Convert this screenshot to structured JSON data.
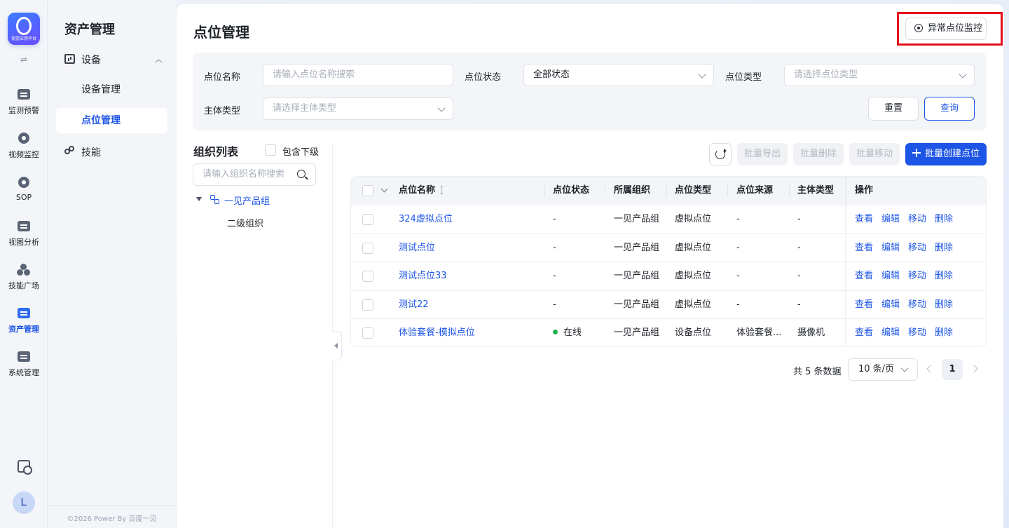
{
  "app": {
    "logo_caption": "视觉应用平台"
  },
  "rail": {
    "items": [
      {
        "label": "监测预警",
        "icon": "monitor-chart-icon"
      },
      {
        "label": "视频监控",
        "icon": "camera-icon"
      },
      {
        "label": "SOP",
        "icon": "sop-icon"
      },
      {
        "label": "视图分析",
        "icon": "view-analysis-icon"
      },
      {
        "label": "技能广场",
        "icon": "skill-square-icon"
      },
      {
        "label": "资产管理",
        "icon": "asset-icon",
        "active": true
      },
      {
        "label": "系统管理",
        "icon": "system-icon"
      }
    ],
    "avatar_initial": "L"
  },
  "sidebar": {
    "title": "资产管理",
    "group_label": "设备",
    "sub_items": [
      "设备管理",
      "点位管理"
    ],
    "skill_label": "技能",
    "footer": "©2026 Power By 百度一见"
  },
  "page": {
    "title": "点位管理",
    "monitor_button": "异常点位监控"
  },
  "filters": {
    "name_label": "点位名称",
    "name_placeholder": "请输入点位名称搜索",
    "status_label": "点位状态",
    "status_value": "全部状态",
    "type_label": "点位类型",
    "type_placeholder": "请选择点位类型",
    "subject_label": "主体类型",
    "subject_placeholder": "请选择主体类型",
    "reset": "重置",
    "query": "查询"
  },
  "org": {
    "title": "组织列表",
    "include_sub": "包含下级",
    "search_placeholder": "请输入组织名称搜索",
    "root": "一见产品组",
    "child": "二级组织"
  },
  "toolbar": {
    "export": "批量导出",
    "delete": "批量删除",
    "move": "批量移动",
    "create": "批量创建点位"
  },
  "table": {
    "headers": [
      "点位名称",
      "点位状态",
      "所属组织",
      "点位类型",
      "点位来源",
      "主体类型",
      "操作"
    ],
    "ops": [
      "查看",
      "编辑",
      "移动",
      "删除"
    ],
    "rows": [
      {
        "name": "324虚拟点位",
        "status": "-",
        "org": "一见产品组",
        "type": "虚拟点位",
        "source": "-",
        "subject": "-"
      },
      {
        "name": "测试点位",
        "status": "-",
        "org": "一见产品组",
        "type": "虚拟点位",
        "source": "-",
        "subject": "-"
      },
      {
        "name": "测试点位33",
        "status": "-",
        "org": "一见产品组",
        "type": "虚拟点位",
        "source": "-",
        "subject": "-"
      },
      {
        "name": "测试22",
        "status": "-",
        "org": "一见产品组",
        "type": "虚拟点位",
        "source": "-",
        "subject": "-"
      },
      {
        "name": "体验套餐-模拟点位",
        "status": "在线",
        "org": "一见产品组",
        "type": "设备点位",
        "source": "体验套餐...",
        "subject": "摄像机"
      }
    ]
  },
  "pagination": {
    "total": "共 5 条数据",
    "page_size": "10 条/页",
    "current": "1"
  },
  "colors": {
    "accent": "#1d55e6",
    "online": "#22b14c",
    "highlight": "#e5101c"
  }
}
